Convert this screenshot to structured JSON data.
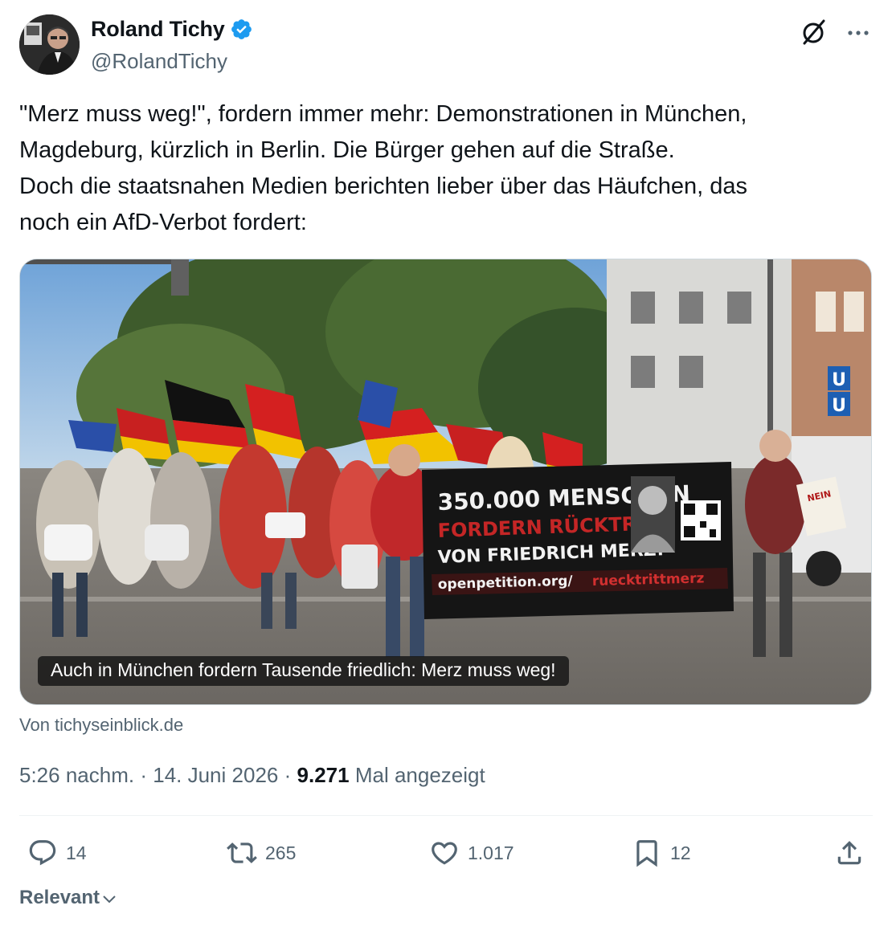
{
  "author": {
    "name": "Roland Tichy",
    "handle": "@RolandTichy",
    "verified": true,
    "verified_color": "#1d9bf0"
  },
  "header_icons": [
    "grok-icon",
    "more-icon"
  ],
  "tweet": {
    "text": "\"Merz muss weg!\", fordern immer mehr: Demonstrationen in München,\nMagdeburg, kürzlich in Berlin. Die Bürger gehen auf die Straße.\nDoch die staatsnahen Medien berichten lieber über das Häufchen, das\nnoch ein AfD-Verbot fordert:"
  },
  "media": {
    "caption": "Auch in München fordern Tausende friedlich: Merz muss weg!",
    "banner": {
      "line1": "350.000 MENSCHEN",
      "line2": "FORDERN RÜCKTRITT",
      "line3": "VON FRIEDRICH MERZ!",
      "url_left": "openpetition.org/",
      "url_right": "ruecktrittmerz"
    },
    "sign_top": "U",
    "sign_bottom": "U",
    "hand_sign": "NEIN"
  },
  "source": "Von tichyseinblick.de",
  "meta": {
    "time": "5:26 nachm.",
    "separator": "·",
    "date": "14. Juni 2026",
    "views_count": "9.271",
    "views_label": "Mal angezeigt"
  },
  "actions": {
    "replies": "14",
    "reposts": "265",
    "likes": "1.017",
    "bookmarks": "12"
  },
  "sort": {
    "label": "Relevant"
  },
  "colors": {
    "text_primary": "#0f1419",
    "text_secondary": "#536471",
    "divider": "#eff3f4"
  }
}
